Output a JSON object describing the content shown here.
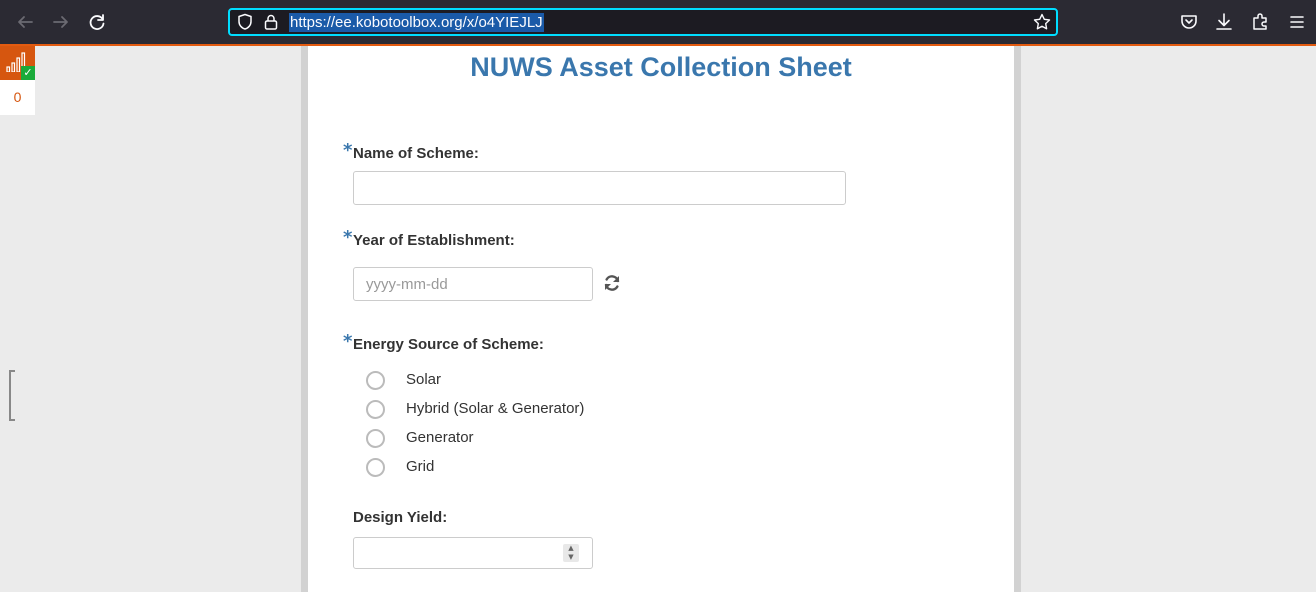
{
  "browser": {
    "url": "https://ee.kobotoolbox.org/x/o4YIEJLJ",
    "icons": {
      "back": "back-arrow-icon",
      "forward": "forward-arrow-icon",
      "reload": "reload-icon",
      "shield": "tracking-protection-icon",
      "lock": "lock-icon",
      "star": "bookmark-star-icon",
      "pocket": "pocket-icon",
      "downloads": "downloads-icon",
      "extensions": "extensions-icon",
      "menu": "hamburger-menu-icon"
    },
    "accent": "#00ddff",
    "progress_color": "#e35b10"
  },
  "offline_widget": {
    "queue_count": "0",
    "color": "#d6560f",
    "check_color": "#1aab3a"
  },
  "form": {
    "title": "NUWS Asset Collection Sheet",
    "title_color": "#3a77ad",
    "required_marker": "*",
    "questions": [
      {
        "label": "Name of Scheme:",
        "required": true,
        "type": "text",
        "value": ""
      },
      {
        "label": "Year of Establishment:",
        "required": true,
        "type": "date",
        "placeholder": "yyyy-mm-dd",
        "value": ""
      },
      {
        "label": "Energy Source of Scheme:",
        "required": true,
        "type": "select_one",
        "options": [
          "Solar",
          "Hybrid (Solar & Generator)",
          "Generator",
          "Grid"
        ]
      },
      {
        "label": "Design Yield:",
        "required": false,
        "type": "number",
        "value": ""
      }
    ]
  }
}
